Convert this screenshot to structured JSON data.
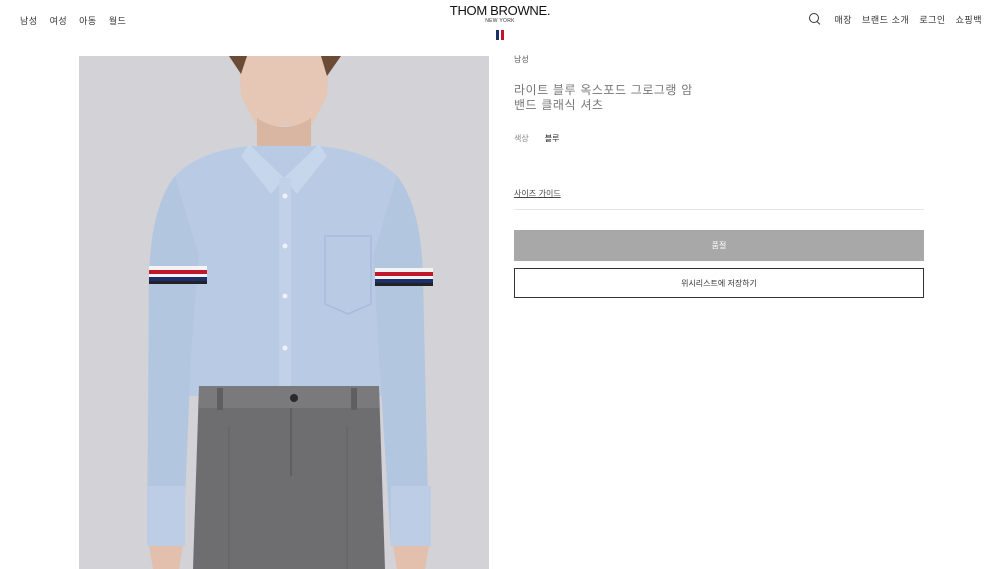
{
  "header": {
    "nav_left": [
      "남성",
      "여성",
      "아동",
      "월드"
    ],
    "brand_name": "THOM BROWNE.",
    "brand_sub": "NEW YORK",
    "nav_right": [
      "매장",
      "브랜드 소개",
      "로그인",
      "쇼핑백"
    ],
    "icons": {
      "search": "search-icon",
      "flag": "tricolor-flag-icon"
    }
  },
  "product": {
    "category": "남성",
    "title": "라이트 블루 옥스포드 그로그랭 암밴드 클래식 셔츠",
    "color_label": "색상",
    "color_value": "블루",
    "size_guide": "사이즈 가이드",
    "soldout_label": "품절",
    "wishlist_label": "위시리스트에 저장하기"
  },
  "colors": {
    "button_soldout": "#a8a8a8",
    "flag_blue": "#1e2d6b",
    "flag_red": "#c0172b",
    "shirt": "#b7c9e2",
    "trousers": "#6e6e70"
  }
}
